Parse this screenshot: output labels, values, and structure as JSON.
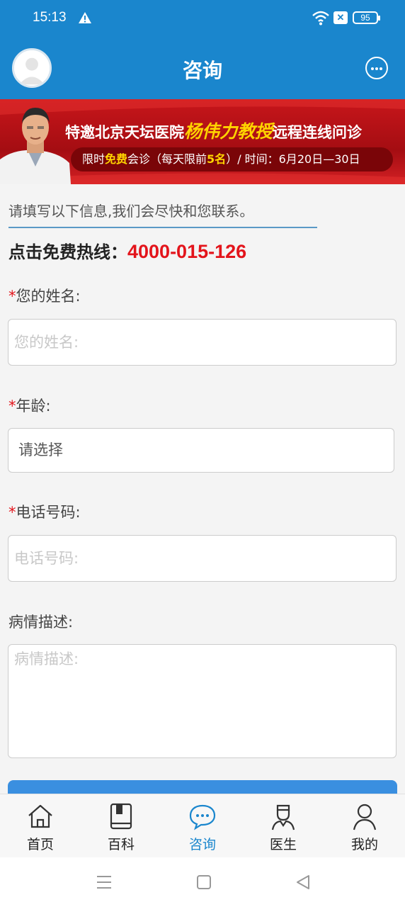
{
  "status_bar": {
    "time": "15:13",
    "battery": "95",
    "icons": [
      "warning-icon",
      "wifi-icon",
      "sim-disabled-icon",
      "battery-icon"
    ]
  },
  "header": {
    "title": "咨询",
    "icons": [
      "avatar-icon",
      "more-icon"
    ]
  },
  "banner": {
    "line1_prefix": "特邀北京天坛医院",
    "line1_name": "杨伟力教授",
    "line1_suffix": "远程连线问诊",
    "line2_a": "限时",
    "line2_free": "免费",
    "line2_b": "会诊（每天限前",
    "line2_count": "5名",
    "line2_c": "）/  时间：6月20日—30日"
  },
  "form": {
    "intro": "请填写以下信息,我们会尽快和您联系。",
    "hotline_label": "点击免费热线：",
    "hotline_number": "4000-015-126",
    "required_mark": "*",
    "name_label": "您的姓名:",
    "name_placeholder": "您的姓名:",
    "age_label": "年龄:",
    "age_value": "请选择",
    "phone_label": "电话号码:",
    "phone_placeholder": "电话号码:",
    "desc_label": "病情描述:",
    "desc_placeholder": "病情描述:"
  },
  "tabbar": {
    "items": [
      {
        "label": "首页",
        "icon": "home-icon"
      },
      {
        "label": "百科",
        "icon": "book-icon"
      },
      {
        "label": "咨询",
        "icon": "chat-icon"
      },
      {
        "label": "医生",
        "icon": "doctor-icon"
      },
      {
        "label": "我的",
        "icon": "user-icon"
      }
    ],
    "active": "咨询"
  },
  "navbar": {
    "icons": [
      "menu-icon",
      "home-square-icon",
      "back-icon"
    ]
  },
  "colors": {
    "brand_blue": "#1a86cd",
    "accent_red": "#e3141b",
    "banner_red": "#c8161b",
    "banner_gold": "#ffd400"
  }
}
